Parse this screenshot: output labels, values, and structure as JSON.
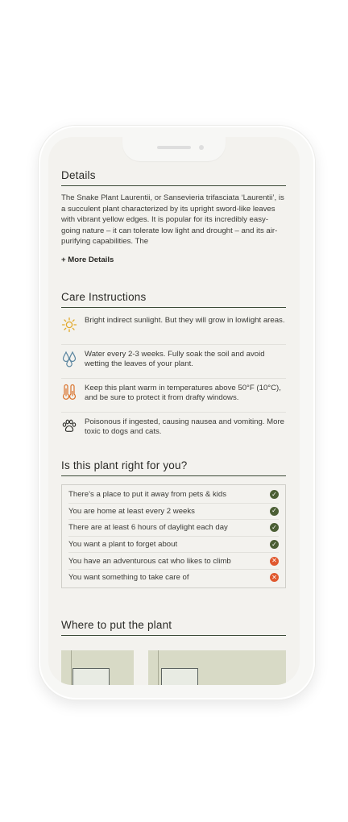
{
  "details": {
    "title": "Details",
    "body": "The Snake Plant Laurentii, or Sansevieria trifasciata ‘Laurentii’, is a succulent plant characterized by its upright sword-like leaves with vibrant yellow edges. It is popular for its incredibly easy-going nature – it can tolerate low light and drought – and its air-purifying capabilities. The",
    "more_label": "+ More Details"
  },
  "care": {
    "title": "Care Instructions",
    "items": [
      {
        "icon": "sun-icon",
        "color": "#e2a92a",
        "text": "Bright indirect sunlight. But they will grow in lowlight areas."
      },
      {
        "icon": "water-drops-icon",
        "color": "#5b86a0",
        "text": "Water every 2-3 weeks. Fully soak the soil and avoid wetting the leaves of your plant."
      },
      {
        "icon": "thermometer-icon",
        "color": "#d9722b",
        "text": "Keep this plant warm in temperatures above 50°F (10°C), and be sure to protect it from drafty windows."
      },
      {
        "icon": "paw-icon",
        "color": "#2a2a26",
        "text": "Poisonous if ingested, causing nausea and vomiting. More toxic to dogs and cats."
      }
    ]
  },
  "right_for_you": {
    "title": "Is this plant right for you?",
    "items": [
      {
        "text": "There’s a place to put it away from pets & kids",
        "ok": true
      },
      {
        "text": "You are home at least every 2 weeks",
        "ok": true
      },
      {
        "text": "There are at least 6 hours of daylight each day",
        "ok": true
      },
      {
        "text": "You want a plant to forget about",
        "ok": true
      },
      {
        "text": "You have an adventurous cat who likes to climb",
        "ok": false
      },
      {
        "text": "You want something to take care of",
        "ok": false
      }
    ]
  },
  "where": {
    "title": "Where to put the plant"
  },
  "colors": {
    "accent_green": "#4b5e34",
    "warning_orange": "#e0582e",
    "screen_bg": "#f3f2ee"
  }
}
